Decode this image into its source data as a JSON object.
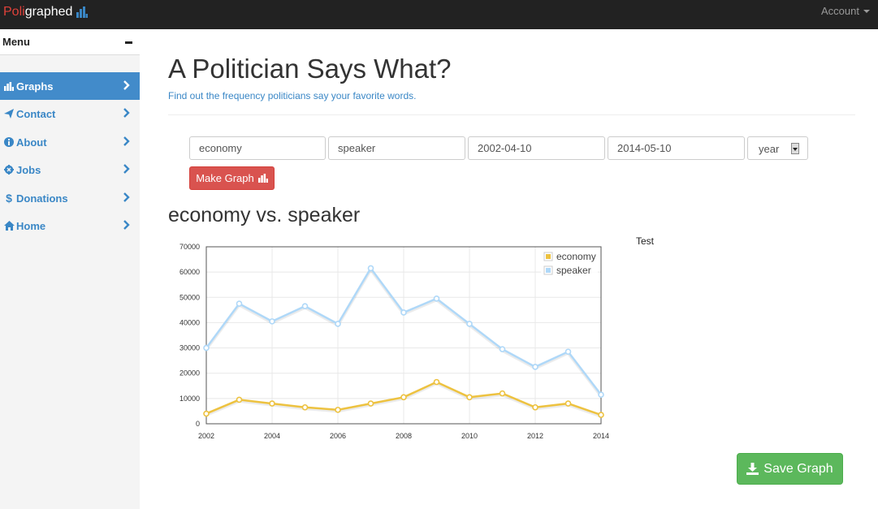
{
  "navbar": {
    "brand_part1": "Poli",
    "brand_part2": "graphed",
    "brand_icon": "bar-chart-icon",
    "account_label": "Account"
  },
  "sidebar": {
    "menu_title": "Menu",
    "items": [
      {
        "label": "Graphs",
        "icon": "bar-chart-icon",
        "active": true
      },
      {
        "label": "Contact",
        "icon": "paper-plane-icon",
        "active": false
      },
      {
        "label": "About",
        "icon": "info-circle-icon",
        "active": false
      },
      {
        "label": "Jobs",
        "icon": "gear-icon",
        "active": false
      },
      {
        "label": "Donations",
        "icon": "dollar-icon",
        "active": false
      },
      {
        "label": "Home",
        "icon": "home-icon",
        "active": false
      }
    ]
  },
  "main": {
    "title": "A Politician Says What?",
    "subtitle": "Find out the frequency politicians say your favorite words.",
    "form": {
      "word1": "economy",
      "word2": "speaker",
      "start_date": "2002-04-10",
      "end_date": "2014-05-10",
      "granularity": "year",
      "make_graph_label": "Make Graph"
    },
    "graph_title": "economy vs. speaker",
    "side_label": "Test",
    "save_label": "Save Graph"
  },
  "colors": {
    "navbar": "#222222",
    "active_nav": "#428bca",
    "link": "#3a87c6",
    "danger": "#d9534f",
    "success": "#5cb85c",
    "economy": "#edc240",
    "speaker": "#afd8f8"
  },
  "chart_data": {
    "type": "line",
    "x": [
      2002,
      2003,
      2004,
      2005,
      2006,
      2007,
      2008,
      2009,
      2010,
      2011,
      2012,
      2013,
      2014
    ],
    "x_ticks": [
      "2002",
      "2004",
      "2006",
      "2008",
      "2010",
      "2012",
      "2014"
    ],
    "y_ticks": [
      "0",
      "10000",
      "20000",
      "30000",
      "40000",
      "50000",
      "60000",
      "70000"
    ],
    "ylim": [
      0,
      70000
    ],
    "xlim": [
      2002,
      2014
    ],
    "grid": true,
    "legend_position": "top-right",
    "series": [
      {
        "name": "economy",
        "color": "#edc240",
        "values": [
          4000,
          9500,
          8000,
          6500,
          5500,
          8000,
          10500,
          16500,
          10500,
          12000,
          6500,
          8000,
          3500
        ]
      },
      {
        "name": "speaker",
        "color": "#afd8f8",
        "values": [
          30000,
          47500,
          40500,
          46500,
          39500,
          61500,
          44000,
          49500,
          39500,
          29500,
          22500,
          28500,
          11500
        ]
      }
    ]
  }
}
